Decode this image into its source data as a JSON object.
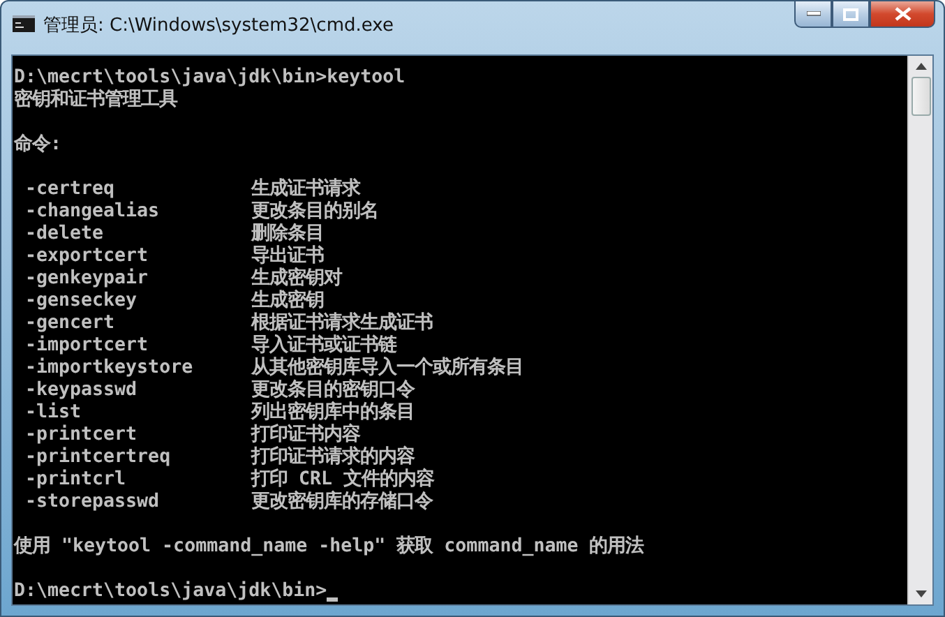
{
  "window": {
    "title": "管理员: C:\\Windows\\system32\\cmd.exe"
  },
  "console": {
    "command_line": "D:\\mecrt\\tools\\java\\jdk\\bin>keytool",
    "heading": "密钥和证书管理工具",
    "commands_label": "命令:",
    "commands": [
      {
        "name": "-certreq",
        "description": "生成证书请求"
      },
      {
        "name": "-changealias",
        "description": "更改条目的别名"
      },
      {
        "name": "-delete",
        "description": "删除条目"
      },
      {
        "name": "-exportcert",
        "description": "导出证书"
      },
      {
        "name": "-genkeypair",
        "description": "生成密钥对"
      },
      {
        "name": "-genseckey",
        "description": "生成密钥"
      },
      {
        "name": "-gencert",
        "description": "根据证书请求生成证书"
      },
      {
        "name": "-importcert",
        "description": "导入证书或证书链"
      },
      {
        "name": "-importkeystore",
        "description": "从其他密钥库导入一个或所有条目"
      },
      {
        "name": "-keypasswd",
        "description": "更改条目的密钥口令"
      },
      {
        "name": "-list",
        "description": "列出密钥库中的条目"
      },
      {
        "name": "-printcert",
        "description": "打印证书内容"
      },
      {
        "name": "-printcertreq",
        "description": "打印证书请求的内容"
      },
      {
        "name": "-printcrl",
        "description": "打印 CRL 文件的内容"
      },
      {
        "name": "-storepasswd",
        "description": "更改密钥库的存储口令"
      }
    ],
    "usage": "使用 \"keytool -command_name -help\" 获取 command_name 的用法",
    "prompt": "D:\\mecrt\\tools\\java\\jdk\\bin>"
  }
}
